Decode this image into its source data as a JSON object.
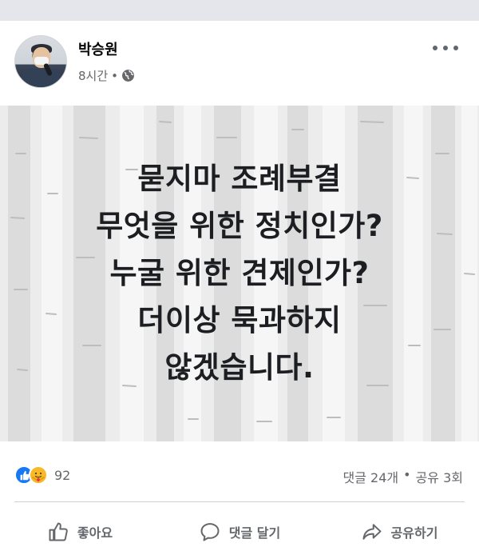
{
  "post": {
    "author": "박승원",
    "time": "8시간",
    "separator": "•",
    "privacy_icon": "globe-icon",
    "more_icon": "more-options-icon",
    "image_text_lines": [
      "묻지마 조례부결",
      "무엇을 위한 정치인가?",
      "누굴 위한 견제인가?",
      "더이상 묵과하지",
      "않겠습니다."
    ]
  },
  "stats": {
    "reaction_icons": [
      "like-icon",
      "care-icon"
    ],
    "reaction_count": "92",
    "comments": "댓글 24개",
    "dot": "•",
    "shares": "공유 3회"
  },
  "actions": {
    "like_label": "좋아요",
    "comment_label": "댓글 달기",
    "share_label": "공유하기"
  },
  "colors": {
    "like_blue": "#1877f2",
    "care_yellow": "#f7b928",
    "meta_gray": "#65676b"
  }
}
